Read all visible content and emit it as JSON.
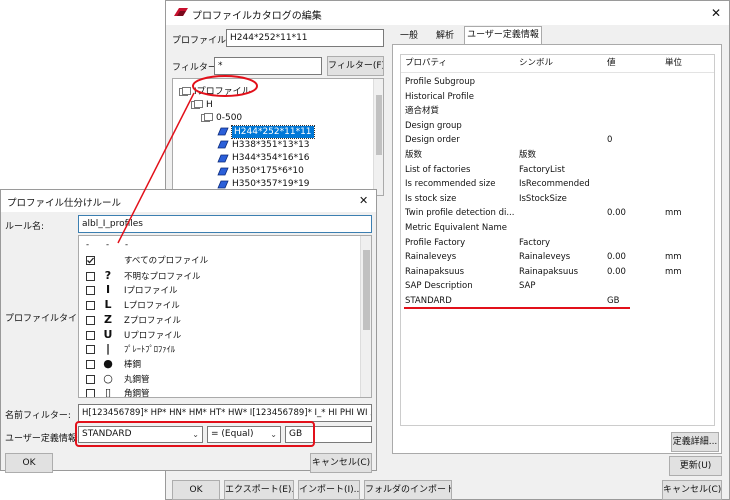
{
  "catalog": {
    "title": "プロファイルカタログの編集",
    "profile_name_label": "プロファイル名:",
    "profile_name_value": "H244*252*11*11",
    "filter_label": "フィルター:",
    "filter_value": "*",
    "filter_button": "フィルター(F)",
    "tree": [
      {
        "label": "Iプロファイル",
        "level": 0,
        "selected": false
      },
      {
        "label": "H",
        "level": 1,
        "selected": false
      },
      {
        "label": "0-500",
        "level": 2,
        "selected": false
      },
      {
        "label": "H244*252*11*11",
        "level": 3,
        "selected": true
      },
      {
        "label": "H338*351*13*13",
        "level": 3,
        "selected": false
      },
      {
        "label": "H344*354*16*16",
        "level": 3,
        "selected": false
      },
      {
        "label": "H350*175*6*10",
        "level": 3,
        "selected": false
      },
      {
        "label": "H350*357*19*19",
        "level": 3,
        "selected": false
      }
    ],
    "tabs": [
      "一般",
      "解析",
      "ユーザー定義情報"
    ],
    "active_tab": 2,
    "prop_headers": {
      "property": "プロパティ",
      "symbol": "シンボル",
      "value": "値",
      "unit": "単位"
    },
    "prop_rows": [
      {
        "property": "Profile Subgroup",
        "symbol": "",
        "value": "",
        "unit": ""
      },
      {
        "property": "Historical Profile",
        "symbol": "",
        "value": "",
        "unit": ""
      },
      {
        "property": "適合材質",
        "symbol": "",
        "value": "",
        "unit": ""
      },
      {
        "property": "Design group",
        "symbol": "",
        "value": "",
        "unit": ""
      },
      {
        "property": "Design order",
        "symbol": "",
        "value": "0",
        "unit": ""
      },
      {
        "property": "版数",
        "symbol": "版数",
        "value": "",
        "unit": ""
      },
      {
        "property": "List of factories",
        "symbol": "FactoryList",
        "value": "",
        "unit": ""
      },
      {
        "property": "Is recommended size",
        "symbol": "IsRecommended",
        "value": "",
        "unit": ""
      },
      {
        "property": "Is stock size",
        "symbol": "IsStockSize",
        "value": "",
        "unit": ""
      },
      {
        "property": "Twin profile detection di...",
        "symbol": "",
        "value": "0.00",
        "unit": "mm"
      },
      {
        "property": "Metric Equivalent Name",
        "symbol": "",
        "value": "",
        "unit": ""
      },
      {
        "property": "Profile Factory",
        "symbol": "Factory",
        "value": "",
        "unit": ""
      },
      {
        "property": "Rainaleveys",
        "symbol": "Rainaleveys",
        "value": "0.00",
        "unit": "mm"
      },
      {
        "property": "Rainapaksuus",
        "symbol": "Rainapaksuus",
        "value": "0.00",
        "unit": "mm"
      },
      {
        "property": "SAP Description",
        "symbol": "SAP",
        "value": "",
        "unit": ""
      },
      {
        "property": "STANDARD",
        "symbol": "",
        "value": "GB",
        "unit": ""
      }
    ],
    "details_button": "定義詳細...",
    "update_button": "更新(U)",
    "ok_button": "OK",
    "export_button": "エクスポート(E)...",
    "import_button": "インポート(I)...",
    "folder_import_button": "フォルダのインポート...",
    "cancel_button": "キャンセル(C)",
    "close_glyph": "✕"
  },
  "rule": {
    "title": "プロファイル仕分けルール",
    "close_glyph": "✕",
    "rule_name_label": "ルール名:",
    "rule_name_value": "albl_I_profiles",
    "profile_type_label": "プロファイルタイプ:",
    "type_header": [
      "-",
      "-",
      "-"
    ],
    "types": [
      {
        "glyph": "",
        "label": "すべてのプロファイル",
        "checked": true
      },
      {
        "glyph": "?",
        "label": "不明なプロファイル",
        "checked": false
      },
      {
        "glyph": "I",
        "label": "Iプロファイル",
        "checked": false
      },
      {
        "glyph": "L",
        "label": "Lプロファイル",
        "checked": false
      },
      {
        "glyph": "Z",
        "label": "Zプロファイル",
        "checked": false
      },
      {
        "glyph": "U",
        "label": "Uプロファイル",
        "checked": false
      },
      {
        "glyph": "|",
        "label": "ﾌﾟﾚｰﾄﾌﾟﾛﾌｧｲﾙ",
        "checked": false
      },
      {
        "glyph": "●",
        "label": "棒鋼",
        "checked": false
      },
      {
        "glyph": "○",
        "label": "丸鋼管",
        "checked": false
      },
      {
        "glyph": "▯",
        "label": "角鋼管",
        "checked": false
      }
    ],
    "name_filter_label": "名前フィルター:",
    "name_filter_value": "H[123456789]* HP* HN* HM* HT* HW* I[123456789]* I_* HI PHI WI ｽﾘﾃｰ",
    "udi_label": "ユーザー定義情報:",
    "udi_attribute": "STANDARD",
    "udi_operator": "= (Equal)",
    "udi_value": "GB",
    "ok_button": "OK",
    "cancel_button": "キャンセル(C)"
  },
  "colors": {
    "highlight": "#e2101a",
    "selection": "#0078d7",
    "dialog_bg": "#f0f0f0"
  }
}
